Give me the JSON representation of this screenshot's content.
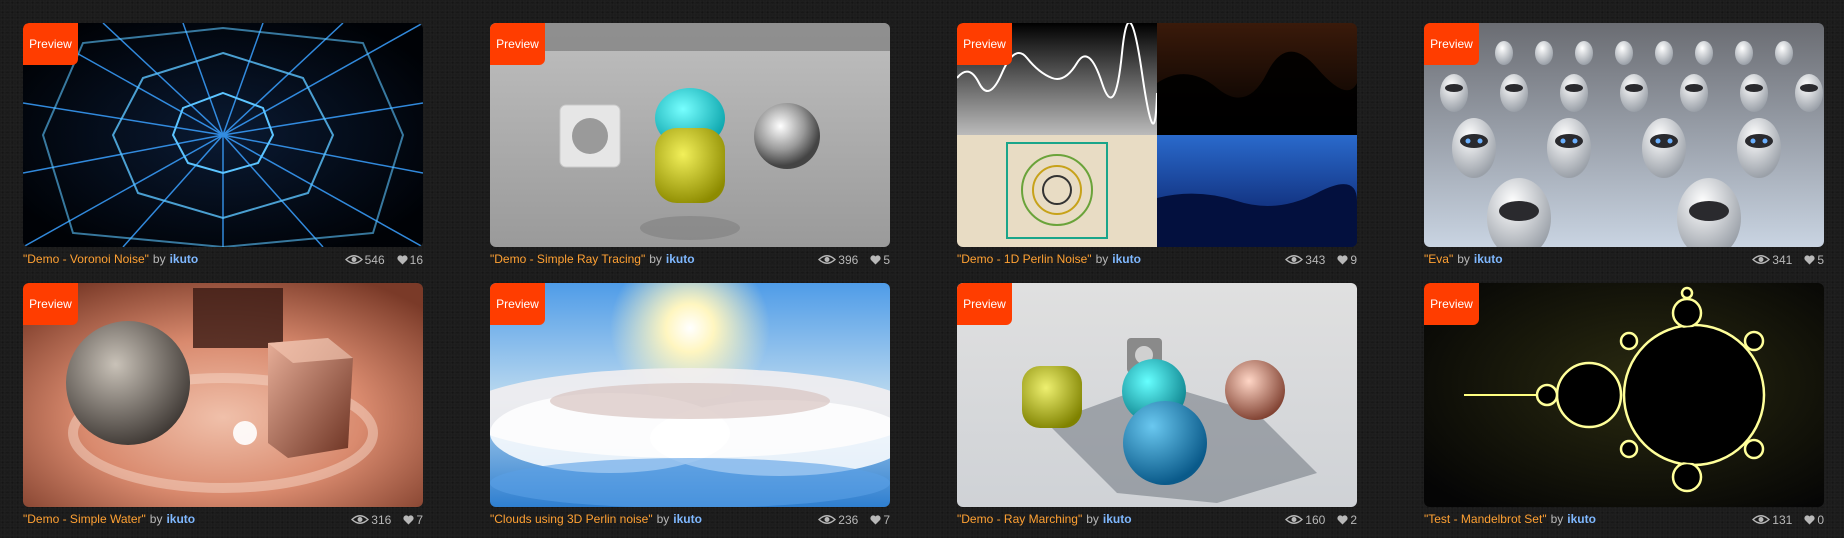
{
  "badge_label": "Preview",
  "by_label": "by",
  "cards": [
    {
      "title": "\"Demo - Voronoi Noise\"",
      "author": "ikuto",
      "views": "546",
      "likes": "16"
    },
    {
      "title": "\"Demo - Simple Ray Tracing\"",
      "author": "ikuto",
      "views": "396",
      "likes": "5"
    },
    {
      "title": "\"Demo - 1D Perlin Noise\"",
      "author": "ikuto",
      "views": "343",
      "likes": "9"
    },
    {
      "title": "\"Eva\"",
      "author": "ikuto",
      "views": "341",
      "likes": "5"
    },
    {
      "title": "\"Demo - Simple Water\"",
      "author": "ikuto",
      "views": "316",
      "likes": "7"
    },
    {
      "title": "\"Clouds using 3D Perlin noise\"",
      "author": "ikuto",
      "views": "236",
      "likes": "7"
    },
    {
      "title": "\"Demo - Ray Marching\"",
      "author": "ikuto",
      "views": "160",
      "likes": "2"
    },
    {
      "title": "\"Test - Mandelbrot Set\"",
      "author": "ikuto",
      "views": "131",
      "likes": "0"
    }
  ],
  "icons": {
    "views": "eye-icon",
    "likes": "heart-icon"
  },
  "colors": {
    "badge": "#ff3d00",
    "title": "#ffa133",
    "author": "#7fb8ff",
    "background": "#1c1c1c"
  }
}
